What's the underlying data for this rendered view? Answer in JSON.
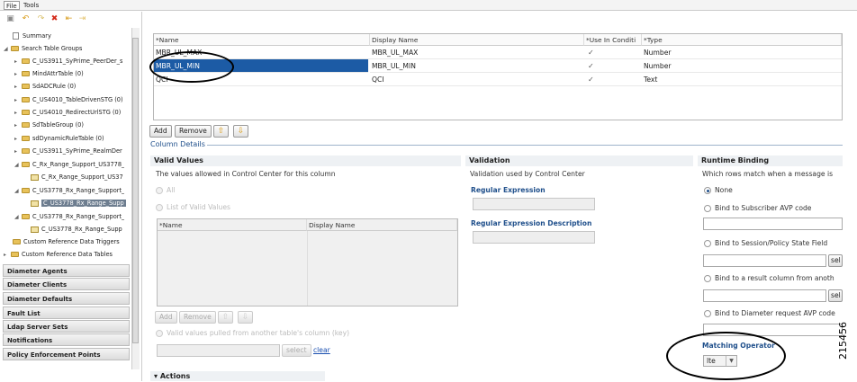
{
  "menu": {
    "file": "File",
    "tools": "Tools"
  },
  "tree": {
    "summary": "Summary",
    "search_table_groups": "Search Table Groups",
    "items": [
      "C_US3911_SyPrime_PeerDer_s",
      "MindAttrTable (0)",
      "SdADCRule (0)",
      "C_US4010_TableDrivenSTG (0)",
      "C_US4010_RedirectUrlSTG (0)",
      "SdTableGroup (0)",
      "sdDynamicRuleTable (0)",
      "C_US3911_SyPrime_RealmDer",
      "C_Rx_Range_Support_US3778_",
      "C_Rx_Range_Support_US37",
      "C_US3778_Rx_Range_Support_",
      "C_US3778_Rx_Range_Supp",
      "C_US3778_Rx_Range_Support_",
      "C_US3778_Rx_Range_Supp"
    ],
    "custom_triggers": "Custom Reference Data Triggers",
    "custom_tables": "Custom Reference Data Tables"
  },
  "accordion": [
    "Diameter Agents",
    "Diameter Clients",
    "Diameter Defaults",
    "Fault List",
    "Ldap Server Sets",
    "Notifications",
    "Policy Enforcement Points"
  ],
  "columns_table": {
    "headers": [
      "*Name",
      "Display Name",
      "*Use In Conditi",
      "*Type"
    ],
    "rows": [
      {
        "name": "MBR_UL_MAX",
        "display": "MBR_UL_MAX",
        "use": "✓",
        "type": "Number"
      },
      {
        "name": "MBR_UL_MIN",
        "display": "MBR_UL_MIN",
        "use": "✓",
        "type": "Number"
      },
      {
        "name": "QCI",
        "display": "QCI",
        "use": "✓",
        "type": "Text"
      }
    ],
    "add": "Add",
    "remove": "Remove"
  },
  "column_details": "Column Details",
  "valid_values": {
    "title": "Valid Values",
    "desc": "The values allowed in Control Center for this column",
    "all": "All",
    "list": "List of Valid Values",
    "headers": [
      "*Name",
      "Display Name"
    ],
    "add": "Add",
    "remove": "Remove",
    "pulled": "Valid values pulled from another table's column (key)",
    "select": "select",
    "clear": "clear"
  },
  "validation": {
    "title": "Validation",
    "desc": "Validation used by Control Center",
    "regex": "Regular Expression",
    "regex_desc": "Regular Expression Description"
  },
  "runtime": {
    "title": "Runtime Binding",
    "desc": "Which rows match when a message is",
    "none": "None",
    "avp": "Bind to Subscriber AVP code",
    "session": "Bind to Session/Policy State Field",
    "result": "Bind to a result column from anoth",
    "diameter": "Bind to Diameter request AVP code",
    "sel": "sel",
    "matching": "Matching Operator",
    "operator": "lte"
  },
  "actions": "Actions",
  "figure_id": "215456"
}
